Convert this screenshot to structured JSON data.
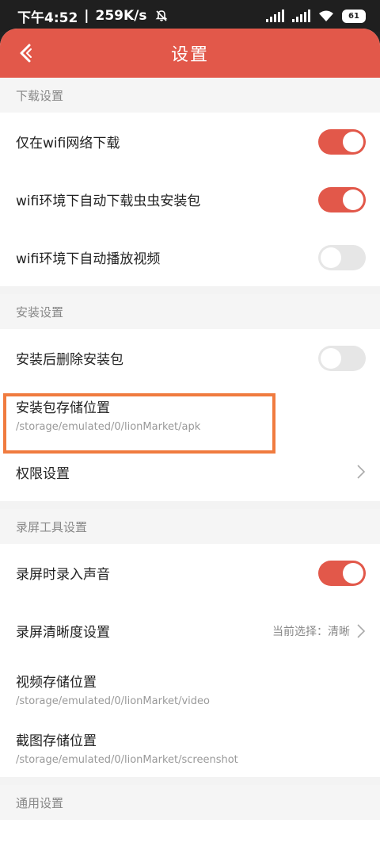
{
  "statusbar": {
    "time": "下午4:52",
    "separator": "|",
    "speed": "259K/s",
    "battery": "61"
  },
  "header": {
    "title": "设置"
  },
  "sections": {
    "download": {
      "title": "下载设置",
      "wifi_only_label": "仅在wifi网络下载",
      "wifi_only_on": true,
      "auto_download_label": "wifi环境下自动下载虫虫安装包",
      "auto_download_on": true,
      "auto_play_label": "wifi环境下自动播放视频",
      "auto_play_on": false
    },
    "install": {
      "title": "安装设置",
      "delete_after_label": "安装后删除安装包",
      "delete_after_on": false,
      "storage_label": "安装包存储位置",
      "storage_path": "/storage/emulated/0/lionMarket/apk",
      "permission_label": "权限设置"
    },
    "record": {
      "title": "录屏工具设置",
      "audio_label": "录屏时录入声音",
      "audio_on": true,
      "clarity_label": "录屏清晰度设置",
      "clarity_current": "当前选择：清晰",
      "video_storage_label": "视频存储位置",
      "video_storage_path": "/storage/emulated/0/lionMarket/video",
      "shot_storage_label": "截图存储位置",
      "shot_storage_path": "/storage/emulated/0/lionMarket/screenshot"
    },
    "general": {
      "title": "通用设置"
    }
  },
  "colors": {
    "accent": "#e2584a",
    "highlight": "#f07b3f",
    "toggle_off": "#e6e6e6"
  },
  "icons": {
    "back": "back-arrow-icon",
    "chevron": "chevron-right-icon",
    "wifi": "wifi-icon",
    "mute": "bell-off-icon"
  }
}
